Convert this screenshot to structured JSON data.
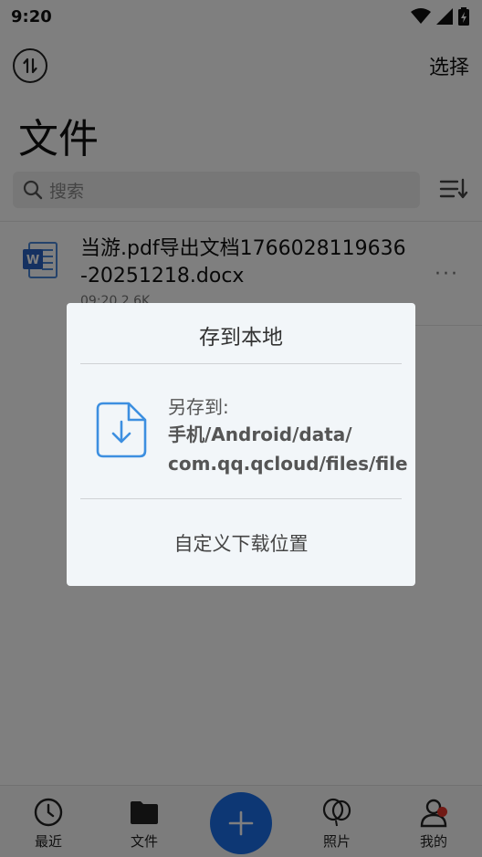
{
  "status_bar": {
    "time": "9:20"
  },
  "header": {
    "select_label": "选择",
    "title": "文件"
  },
  "search": {
    "placeholder": "搜索"
  },
  "file": {
    "name": "当游.pdf导出文档1766028119636-20251218.docx",
    "meta": "09:20  2.6K",
    "more": "···"
  },
  "dialog": {
    "title": "存到本地",
    "save_label": "另存到:",
    "save_path": "手机/Android/data/\ncom.qq.qcloud/files/file",
    "custom_location": "自定义下载位置"
  },
  "nav": {
    "recent": "最近",
    "files": "文件",
    "photos": "照片",
    "mine": "我的"
  },
  "colors": {
    "accent": "#1a6fe8",
    "badge": "#e2352b",
    "dialog_bg": "#f2f6f9",
    "doc_icon": "#3d8fe0"
  }
}
